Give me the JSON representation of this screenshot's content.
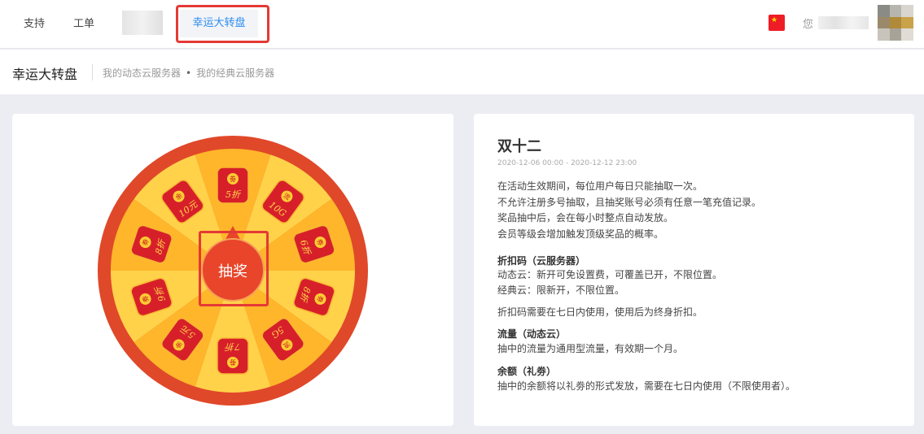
{
  "nav": {
    "support": "支持",
    "ticket": "工单",
    "active": "幸运大转盘",
    "greeting": "您"
  },
  "subheader": {
    "title": "幸运大转盘",
    "links": [
      "我的动态云服务器",
      "我的经典云服务器"
    ],
    "separator": "•"
  },
  "wheel": {
    "draw_label": "抽奖",
    "prizes": [
      {
        "badge": "劵",
        "text": "5折"
      },
      {
        "badge": "流",
        "text": "10G"
      },
      {
        "badge": "劵",
        "text": "6折"
      },
      {
        "badge": "劵",
        "text": "8折"
      },
      {
        "badge": "流",
        "text": "5G"
      },
      {
        "badge": "劵",
        "text": "7折"
      },
      {
        "badge": "余",
        "text": "5元"
      },
      {
        "badge": "劵",
        "text": "9折"
      },
      {
        "badge": "劵",
        "text": "8折"
      },
      {
        "badge": "余",
        "text": "10元"
      }
    ],
    "colors": {
      "outer": "#e0482a",
      "light": "#ffd24a",
      "dark": "#ffb62a",
      "badge": "#d71f2a"
    }
  },
  "event": {
    "title": "双十二",
    "period": "2020-12-06 00:00 - 2020-12-12 23:00",
    "rules": [
      "在活动生效期间，每位用户每日只能抽取一次。",
      "不允许注册多号抽取，且抽奖账号必须有任意一笔充值记录。",
      "奖品抽中后，会在每小时整点自动发放。",
      "会员等级会增加触发顶级奖品的概率。"
    ],
    "discount": {
      "heading": "折扣码（云服务器）",
      "lines": [
        "动态云：新开可免设置费，可覆盖已开，不限位置。",
        "经典云：限新开，不限位置。"
      ],
      "note": "折扣码需要在七日内使用，使用后为终身折扣。"
    },
    "traffic": {
      "heading": "流量（动态云）",
      "text": "抽中的流量为通用型流量，有效期一个月。"
    },
    "balance": {
      "heading": "余额（礼劵）",
      "text": "抽中的余额将以礼劵的形式发放，需要在七日内使用（不限使用者）。"
    }
  }
}
